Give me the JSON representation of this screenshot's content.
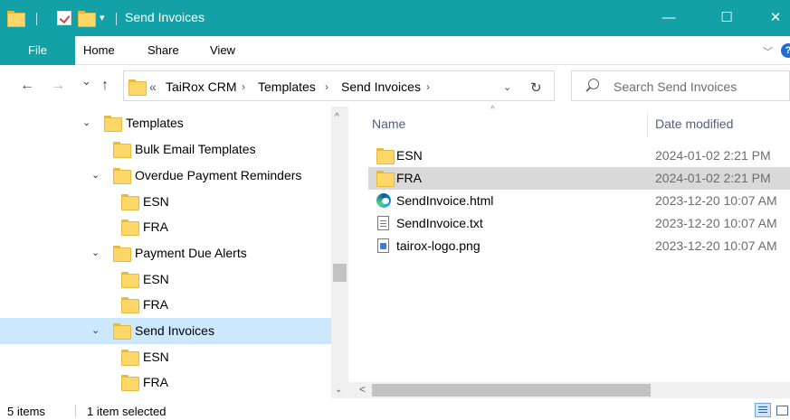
{
  "window": {
    "title": "Send Invoices",
    "minimize_glyph": "—",
    "maximize_glyph": "☐",
    "close_glyph": "✕",
    "accent_color": "#14a0a7"
  },
  "ribbon": {
    "tabs": [
      "File",
      "Home",
      "Share",
      "View"
    ],
    "expand_glyph": "﹀",
    "help_glyph": "?"
  },
  "nav_glyphs": {
    "back": "←",
    "forward": "→",
    "recent": "⌄",
    "up": "↑",
    "refresh": "↻",
    "dropdown": "⌄"
  },
  "address": {
    "overflow": "«",
    "separator": "›",
    "crumbs": [
      "TaiRox CRM",
      "Templates",
      "Send Invoices"
    ]
  },
  "search": {
    "placeholder": "Search Send Invoices"
  },
  "tree": [
    {
      "label": "Templates",
      "expander": "⌄"
    },
    {
      "label": "Bulk Email Templates",
      "expander": ""
    },
    {
      "label": "Overdue Payment Reminders",
      "expander": "⌄"
    },
    {
      "label": "ESN",
      "expander": ""
    },
    {
      "label": "FRA",
      "expander": ""
    },
    {
      "label": "Payment Due Alerts",
      "expander": "⌄"
    },
    {
      "label": "ESN",
      "expander": ""
    },
    {
      "label": "FRA",
      "expander": ""
    },
    {
      "label": "Send Invoices",
      "expander": "⌄",
      "selected": true
    },
    {
      "label": "ESN",
      "expander": ""
    },
    {
      "label": "FRA",
      "expander": ""
    }
  ],
  "columns": {
    "name": "Name",
    "date_modified": "Date modified",
    "sort_glyph": "^"
  },
  "files": [
    {
      "name": "ESN",
      "date": "2024-01-02 2:21 PM",
      "icon": "folder-icon"
    },
    {
      "name": "FRA",
      "date": "2024-01-02 2:21 PM",
      "icon": "folder-icon",
      "selected": true
    },
    {
      "name": "SendInvoice.html",
      "date": "2023-12-20 10:07 AM",
      "icon": "edge-html-icon"
    },
    {
      "name": "SendInvoice.txt",
      "date": "2023-12-20 10:07 AM",
      "icon": "text-file-icon"
    },
    {
      "name": "tairox-logo.png",
      "date": "2023-12-20 10:07 AM",
      "icon": "image-file-icon"
    }
  ],
  "scroll_glyphs": {
    "up": "^",
    "down": "⌄",
    "left": "<"
  },
  "status": {
    "items": "5 items",
    "selection": "1 item selected"
  }
}
